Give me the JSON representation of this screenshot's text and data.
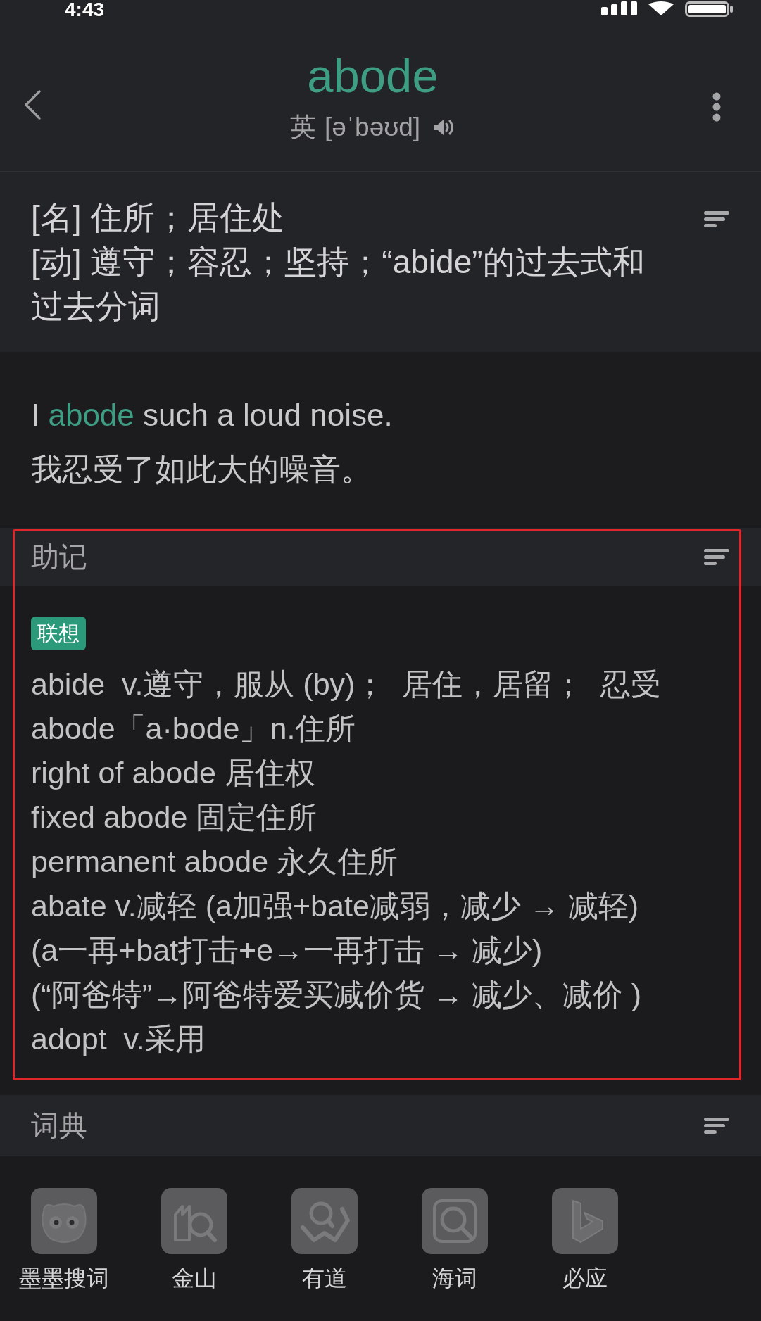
{
  "status_bar": {
    "time": "4:43"
  },
  "header": {
    "word": "abode",
    "accent": "英",
    "phonetic": "[əˈbəʊd]"
  },
  "definitions": [
    "[名] 住所；居住处",
    "[动] 遵守；容忍；坚持；“abide”的过去式和过去分词"
  ],
  "example": {
    "sentence": [
      {
        "text": "I",
        "highlight": false
      },
      {
        "text": "abode",
        "highlight": true
      },
      {
        "text": "such a loud noise.",
        "highlight": false
      }
    ],
    "translation": "我忍受了如此大的噪音。"
  },
  "mnemonic": {
    "title": "助记",
    "highlighted": true,
    "tag": "联想",
    "lines": [
      "abide  v.遵守，服从 (by)；  居住，居留；  忍受",
      "abode「a·bode」n.住所",
      "right of abode 居住权",
      "fixed abode 固定住所",
      "permanent abode 永久住所",
      "abate v.减轻 (a加强+bate减弱，减少 → 减轻)",
      "(a一再+bat打击+e→一再打击 → 减少)",
      "(“阿爸特”→阿爸特爱买减价货 → 减少、减价 )",
      "adopt  v.采用"
    ]
  },
  "dictionaries": {
    "title": "词典",
    "items": [
      {
        "label": "墨墨搜词",
        "kind": "owl"
      },
      {
        "label": "金山",
        "kind": "building"
      },
      {
        "label": "有道",
        "kind": "book"
      },
      {
        "label": "海词",
        "kind": "lens"
      },
      {
        "label": "必应",
        "kind": "bing"
      }
    ]
  }
}
